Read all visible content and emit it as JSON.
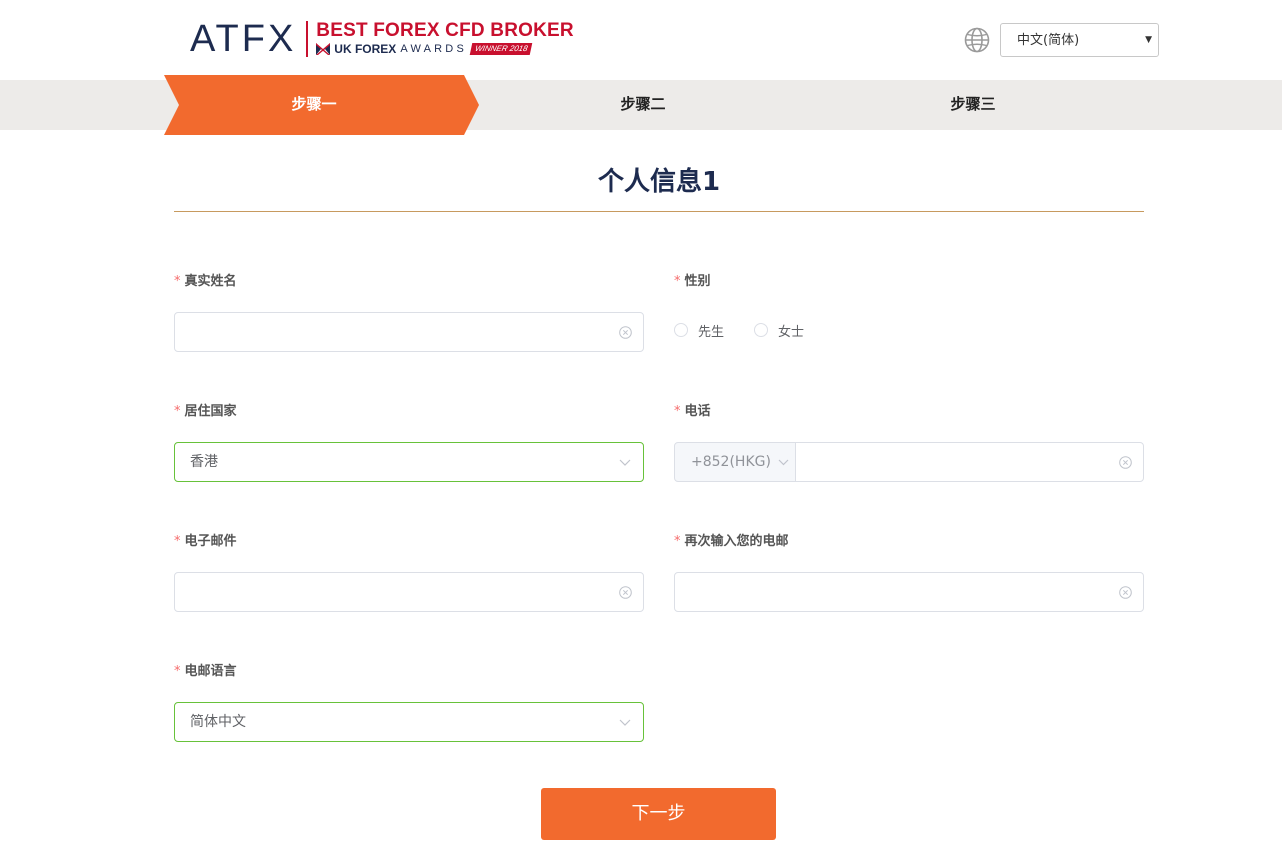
{
  "header": {
    "logo": {
      "brand": "ATFX",
      "award_line1": "BEST FOREX CFD BROKER",
      "award_org": "UK FOREX",
      "award_name": "AWARDS",
      "award_badge": "WINNER 2018"
    },
    "globe_icon": "globe-icon",
    "language_select": {
      "value": "中文(简体)"
    }
  },
  "steps": [
    {
      "label": "步骤一",
      "active": true
    },
    {
      "label": "步骤二",
      "active": false
    },
    {
      "label": "步骤三",
      "active": false
    }
  ],
  "page_title": "个人信息1",
  "form": {
    "real_name": {
      "label": "真实姓名",
      "required_mark": "*",
      "value": ""
    },
    "gender": {
      "label": "性别",
      "required_mark": "*",
      "options": [
        "先生",
        "女士"
      ]
    },
    "country": {
      "label": "居住国家",
      "required_mark": "*",
      "value": "香港"
    },
    "phone": {
      "label": "电话",
      "required_mark": "*",
      "prefix": "+852(HKG)",
      "value": ""
    },
    "email": {
      "label": "电子邮件",
      "required_mark": "*",
      "value": ""
    },
    "email_confirm": {
      "label": "再次输入您的电邮",
      "required_mark": "*",
      "value": ""
    },
    "email_language": {
      "label": "电邮语言",
      "required_mark": "*",
      "value": "简体中文"
    }
  },
  "next_button": "下一步",
  "colors": {
    "accent_orange": "#f26a2e",
    "brand_navy": "#1d2b4f",
    "brand_red": "#c8102e",
    "valid_green": "#67c23a",
    "required_red": "#f56c6c"
  }
}
